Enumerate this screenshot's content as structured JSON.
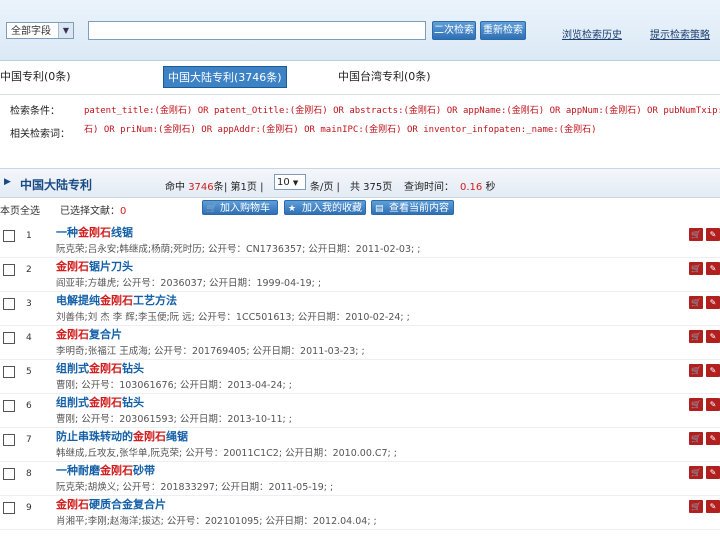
{
  "search": {
    "field_value": "全部字段",
    "query_value": "",
    "btn_search2": "二次检索",
    "btn_research": "重新检索",
    "link_history": "浏览检索历史",
    "link_help": "提示检索策略"
  },
  "sources": {
    "cn_patent": "中国专利(0条)",
    "mainland": "中国大陆专利(3746条)",
    "taiwan": "中国台湾专利(0条)"
  },
  "query": {
    "label1": "检索条件：",
    "label2": "相关检索词：",
    "text1": "patent_title:(金刚石) OR patent_Otitle:(金刚石) OR abstracts:(金刚石) OR appName:(金刚石) OR appNum:(金刚石) OR pubNumTxip:(金刚",
    "text2": "石) OR priNum:(金刚石) OR appAddr:(金刚石) OR mainIPC:(金刚石) OR inventor_infopaten:_name:(金刚石)"
  },
  "results_bar": {
    "title": "中国大陆专利",
    "hit_prefix": "命中 ",
    "hit_count": "3746",
    "hit_suffix": "条",
    "page": "| 第1页 |",
    "per_page": "10",
    "per_page_unit": "条/页 |",
    "total_pages": "共 375页",
    "time_label": "查询时间：",
    "time_value": "0.16",
    "time_unit": "秒"
  },
  "toolbar": {
    "select_all": "本页全选",
    "selected_label": "已选择文献：",
    "selected_count": "0",
    "btn_cart": "加入购物车",
    "btn_fav": "加入我的收藏",
    "btn_view": "查看当前内容"
  },
  "results": [
    {
      "num": "1",
      "title_pre": "一种",
      "title_hl": "金刚石",
      "title_post": "线锯",
      "meta": "阮克荣;吕永安;韩继成;杨荫;死时历; 公开号：CN1736357; 公开日期：2011-02-03; ;"
    },
    {
      "num": "2",
      "title_pre": "",
      "title_hl": "金刚石",
      "title_post": "锯片刀头",
      "meta": "阎亚菲;方雄虎; 公开号：2036037; 公开日期：1999-04-19; ;"
    },
    {
      "num": "3",
      "title_pre": "电解提纯",
      "title_hl": "金刚石",
      "title_post": "工艺方法",
      "meta": "刘善伟;刘 杰 李 辉;李玉便;阮 远; 公开号：1CC501613; 公开日期：2010-02-24; ;"
    },
    {
      "num": "4",
      "title_pre": "",
      "title_hl": "金刚石",
      "title_post": "复合片",
      "meta": "李明奇;张福江 王成海; 公开号：201769405; 公开日期：2011-03-23; ;"
    },
    {
      "num": "5",
      "title_pre": "组削式",
      "title_hl": "金刚石",
      "title_post": "钻头",
      "meta": "曹刚; 公开号：103061676; 公开日期：2013-04-24; ;"
    },
    {
      "num": "6",
      "title_pre": "组削式",
      "title_hl": "金刚石",
      "title_post": "钻头",
      "meta": "曹刚; 公开号：203061593; 公开日期：2013-10-11; ;"
    },
    {
      "num": "7",
      "title_pre": "防止串珠转动的",
      "title_hl": "金刚石",
      "title_post": "绳锯",
      "meta": "韩继成,丘攻友,张华单,阮克荣; 公开号：20011C1C2; 公开日期：2010.00.C7; ;"
    },
    {
      "num": "8",
      "title_pre": "一种耐磨",
      "title_hl": "金刚石",
      "title_post": "砂带",
      "meta": "阮克荣;胡焕义; 公开号：201833297; 公开日期：2011-05-19; ;"
    },
    {
      "num": "9",
      "title_pre": "",
      "title_hl": "金刚石",
      "title_post": "硬质合金复合片",
      "meta": "肖湘平;李刚;赵海洋;拔达; 公开号：202101095; 公开日期：2012.04.04; ;"
    }
  ]
}
